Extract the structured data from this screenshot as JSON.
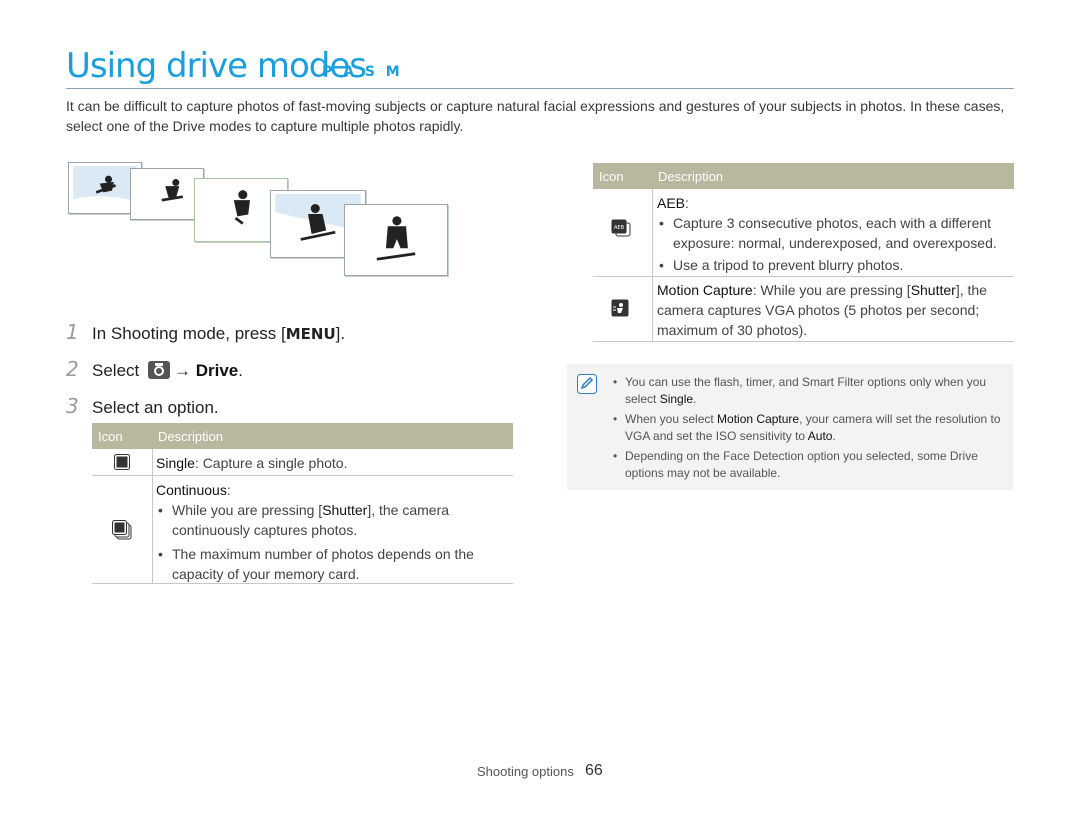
{
  "page": {
    "title": "Using drive modes",
    "modes": "P A S M",
    "intro": "It can be difficult to capture photos of fast-moving subjects or capture natural facial expressions and gestures of your subjects in photos. In these cases, select one of the Drive modes to capture multiple photos rapidly."
  },
  "steps": [
    {
      "num": "1",
      "text_before": "In Shooting mode, press [",
      "key": "MENU",
      "text_after": "]."
    },
    {
      "num": "2",
      "text_before": "Select",
      "arrow": "→",
      "bold": "Drive",
      "text_after": "."
    },
    {
      "num": "3",
      "text": "Select an option."
    }
  ],
  "left_table": {
    "header_icon": "Icon",
    "header_desc": "Description",
    "single": {
      "icon": "single-shot-icon",
      "name": "Single",
      "rest": ": Capture a single photo."
    },
    "continuous": {
      "icon": "continuous-shot-icon",
      "name": "Continuous",
      "colon": ":",
      "bullet1_a": "While you are pressing [",
      "bullet1_key": "Shutter",
      "bullet1_b": "], the camera continuously captures photos.",
      "bullet2": "The maximum number of photos depends on the capacity of your memory card."
    }
  },
  "right_table": {
    "header_icon": "Icon",
    "header_desc": "Description",
    "aeb": {
      "icon": "aeb-icon",
      "name": "AEB",
      "colon": ":",
      "bullet1": "Capture 3 consecutive photos, each with a different exposure: normal, underexposed, and overexposed.",
      "bullet2": "Use a tripod to prevent blurry photos."
    },
    "motion": {
      "icon": "motion-capture-icon",
      "name": "Motion Capture",
      "text_a": ": While you are pressing [",
      "key": "Shutter",
      "text_b": "], the camera captures VGA photos (5 photos per second; maximum of 30 photos)."
    }
  },
  "note": {
    "icon": "note-pencil-icon",
    "item1_a": "You can use the flash, timer, and Smart Filter options only when you select ",
    "item1_bold": "Single",
    "item1_b": ".",
    "item2_a": "When you select ",
    "item2_bold1": "Motion Capture",
    "item2_b": ", your camera will set the resolution to VGA and set the ISO sensitivity to ",
    "item2_bold2": "Auto",
    "item2_c": ".",
    "item3": "Depending on the Face Detection option you selected, some Drive options may not be available."
  },
  "footer": {
    "section": "Shooting options",
    "page": "66"
  },
  "colors": {
    "accent": "#1a9fde",
    "table_header": "#b9b79d"
  }
}
